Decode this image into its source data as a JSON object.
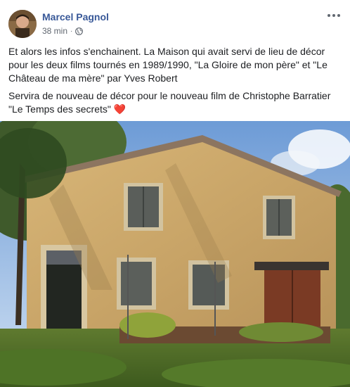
{
  "post": {
    "author": "Marcel Pagnol",
    "time": "38 min",
    "separator": "·",
    "paragraph1": "Et alors les infos s'enchainent. La Maison qui avait servi de lieu de décor pour les deux films tournés en 1989/1990, \"La Gloire de mon père\" et \"Le Château de ma mère\" par Yves Robert",
    "paragraph2": "Servira de nouveau de décor pour le nouveau film de Christophe Barratier \"Le Temps des secrets\"",
    "emoji": "❤️"
  },
  "icons": {
    "audience": "globe-icon",
    "menu": "more-options-icon"
  },
  "colors": {
    "author_link": "#385898",
    "meta_text": "#606770",
    "heart": "#e0245e"
  }
}
